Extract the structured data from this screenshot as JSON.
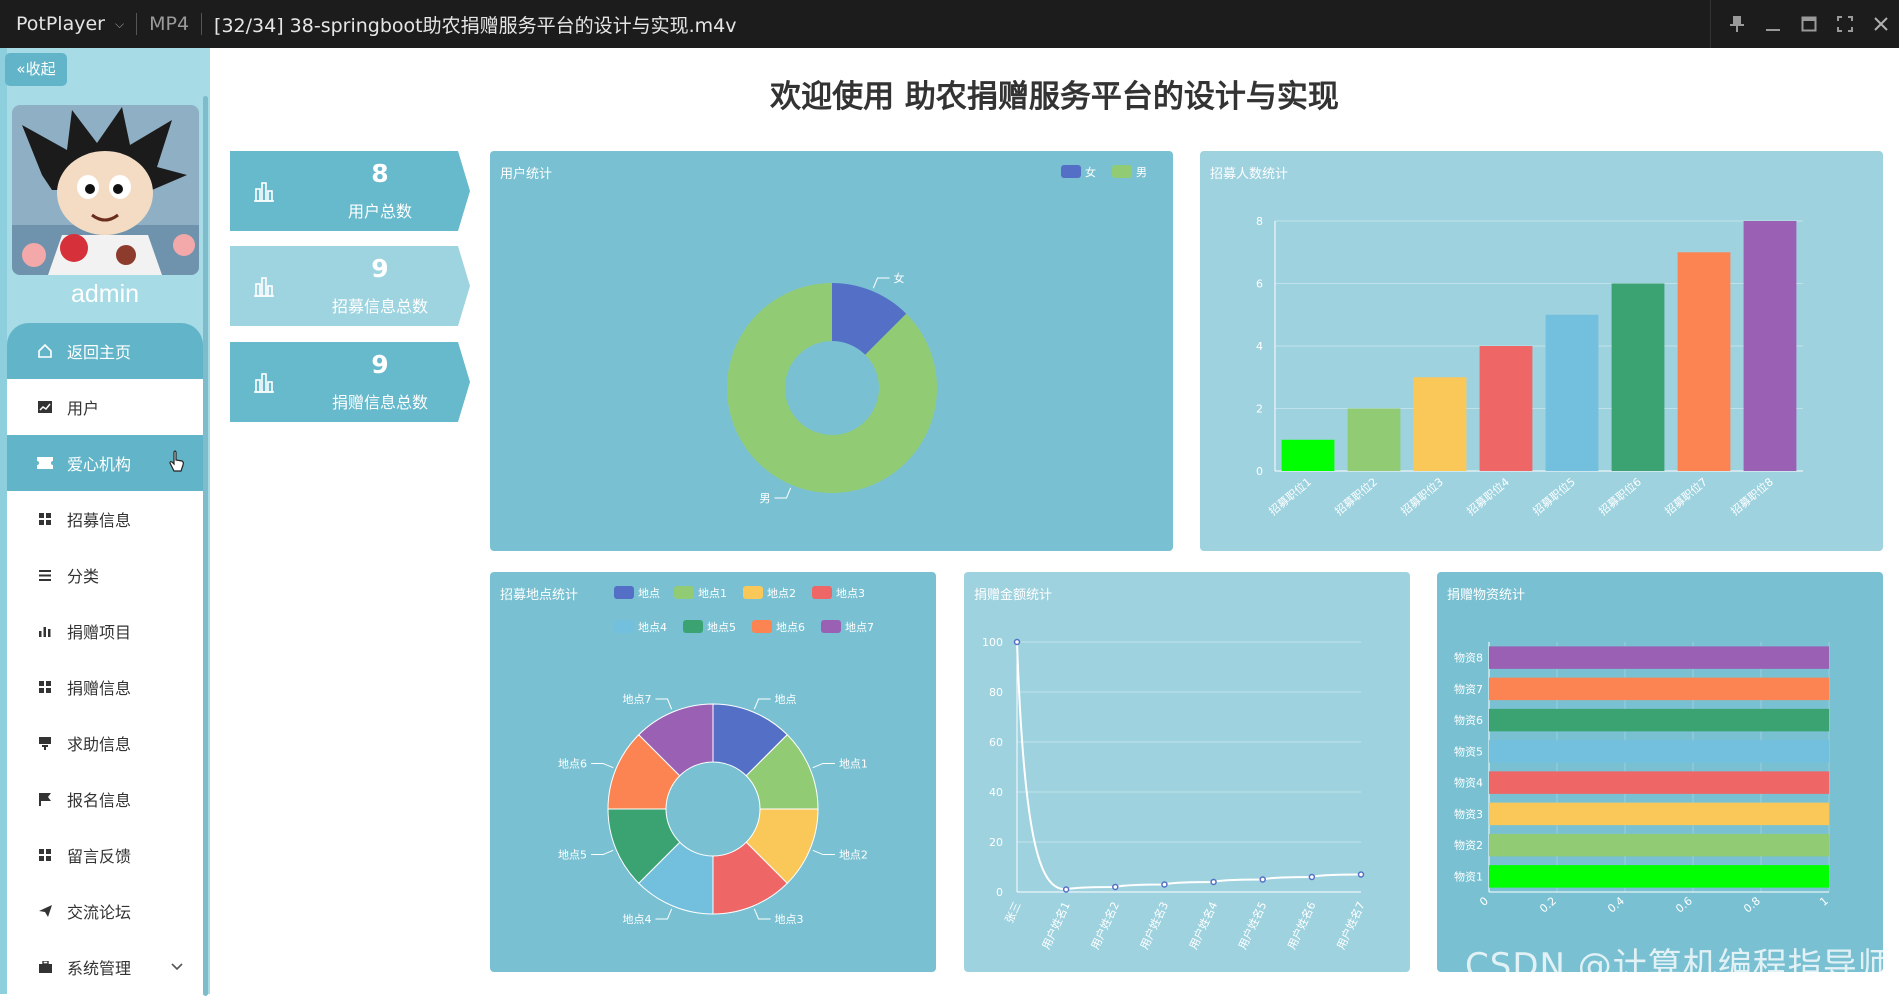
{
  "window": {
    "app_name": "PotPlayer",
    "format": "MP4",
    "file_title": "[32/34] 38-springboot助农捐赠服务平台的设计与实现.m4v"
  },
  "sidebar": {
    "collapse_label": "收起",
    "username": "admin",
    "items": [
      {
        "label": "返回主页",
        "icon": "home-icon"
      },
      {
        "label": "用户",
        "icon": "chart-icon"
      },
      {
        "label": "爱心机构",
        "icon": "ticket-icon"
      },
      {
        "label": "招募信息",
        "icon": "grid-icon"
      },
      {
        "label": "分类",
        "icon": "list-icon"
      },
      {
        "label": "捐赠项目",
        "icon": "bar-icon"
      },
      {
        "label": "捐赠信息",
        "icon": "grid-icon"
      },
      {
        "label": "求助信息",
        "icon": "cup-icon"
      },
      {
        "label": "报名信息",
        "icon": "flag-icon"
      },
      {
        "label": "留言反馈",
        "icon": "grid-icon"
      },
      {
        "label": "交流论坛",
        "icon": "send-icon"
      },
      {
        "label": "系统管理",
        "icon": "briefcase-icon"
      }
    ]
  },
  "main": {
    "title": "欢迎使用 助农捐赠服务平台的设计与实现",
    "stats": [
      {
        "value": "8",
        "label": "用户总数"
      },
      {
        "value": "9",
        "label": "招募信息总数"
      },
      {
        "value": "9",
        "label": "捐赠信息总数"
      }
    ]
  },
  "chart_data": [
    {
      "type": "pie",
      "title": "用户统计",
      "donut": true,
      "legend": "top-right",
      "slices": [
        {
          "name": "女",
          "value": 1,
          "color": "#5470c6"
        },
        {
          "name": "男",
          "value": 7,
          "color": "#91cc75"
        }
      ]
    },
    {
      "type": "bar",
      "title": "招募人数统计",
      "categories": [
        "招募职位1",
        "招募职位2",
        "招募职位3",
        "招募职位4",
        "招募职位5",
        "招募职位6",
        "招募职位7",
        "招募职位8"
      ],
      "values": [
        1,
        2,
        3,
        4,
        5,
        6,
        7,
        8
      ],
      "colors": [
        "#00ff00",
        "#91cc75",
        "#fac858",
        "#ee6666",
        "#73c0de",
        "#3ba272",
        "#fc8452",
        "#9a60b4"
      ],
      "yticks": [
        "0",
        "2",
        "4",
        "6",
        "8"
      ],
      "ylim": [
        0,
        8
      ]
    },
    {
      "type": "pie",
      "title": "招募地点统计",
      "donut": true,
      "legend": "top",
      "slices": [
        {
          "name": "地点",
          "value": 1,
          "color": "#5470c6"
        },
        {
          "name": "地点1",
          "value": 1,
          "color": "#91cc75"
        },
        {
          "name": "地点2",
          "value": 1,
          "color": "#fac858"
        },
        {
          "name": "地点3",
          "value": 1,
          "color": "#ee6666"
        },
        {
          "name": "地点4",
          "value": 1,
          "color": "#73c0de"
        },
        {
          "name": "地点5",
          "value": 1,
          "color": "#3ba272"
        },
        {
          "name": "地点6",
          "value": 1,
          "color": "#fc8452"
        },
        {
          "name": "地点7",
          "value": 1,
          "color": "#9a60b4"
        }
      ]
    },
    {
      "type": "line",
      "title": "捐赠金额统计",
      "x": [
        "张三",
        "用户姓名1",
        "用户姓名2",
        "用户姓名3",
        "用户姓名4",
        "用户姓名5",
        "用户姓名6",
        "用户姓名7"
      ],
      "values": [
        100,
        1,
        2,
        3,
        4,
        5,
        6,
        7
      ],
      "yticks": [
        "0",
        "20",
        "40",
        "60",
        "80",
        "100"
      ],
      "ylim": [
        0,
        100
      ],
      "smooth": true
    },
    {
      "type": "bar",
      "orientation": "horizontal",
      "title": "捐赠物资统计",
      "categories": [
        "物资1",
        "物资2",
        "物资3",
        "物资4",
        "物资5",
        "物资6",
        "物资7",
        "物资8"
      ],
      "values": [
        1,
        1,
        1,
        1,
        1,
        1,
        1,
        1
      ],
      "colors": [
        "#00ff00",
        "#91cc75",
        "#fac858",
        "#ee6666",
        "#73c0de",
        "#3ba272",
        "#fc8452",
        "#9a60b4"
      ],
      "xticks": [
        "0",
        "0.2",
        "0.4",
        "0.6",
        "0.8",
        "1"
      ],
      "xlim": [
        0,
        1
      ]
    }
  ],
  "watermark": "CSDN @计算机编程指导师"
}
